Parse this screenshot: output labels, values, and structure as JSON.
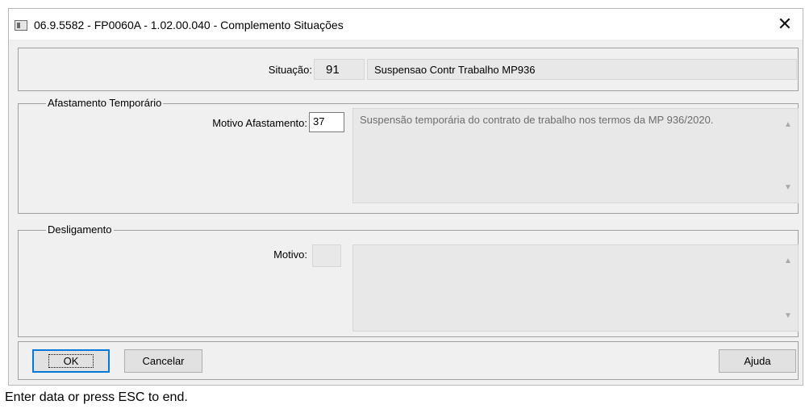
{
  "window": {
    "title": "06.9.5582 - FP0060A - 1.02.00.040 - Complemento Situações",
    "close_glyph": "✕"
  },
  "situacao": {
    "label": "Situação:",
    "code": "91",
    "description": "Suspensao Contr Trabalho MP936"
  },
  "afastamento": {
    "group_title": "Afastamento Temporário",
    "motivo_label": "Motivo Afastamento:",
    "motivo_code": "37",
    "motivo_text": "Suspensão temporária do contrato de trabalho nos termos da MP 936/2020."
  },
  "desligamento": {
    "group_title": "Desligamento",
    "motivo_label": "Motivo:",
    "motivo_code": "",
    "motivo_text": ""
  },
  "buttons": {
    "ok": "OK",
    "cancel": "Cancelar",
    "help": "Ajuda"
  },
  "status": {
    "message": "Enter data or press ESC to end."
  },
  "icons": {
    "app": "window-app-icon",
    "close": "close-icon",
    "scroll_up": "scroll-up-icon",
    "scroll_down": "scroll-down-icon"
  }
}
